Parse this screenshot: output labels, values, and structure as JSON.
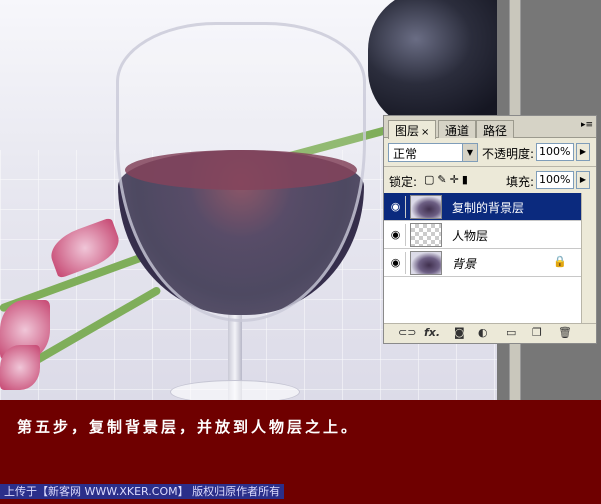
{
  "layers_panel": {
    "tabs": [
      {
        "label": "图层",
        "active": true,
        "close": "×"
      },
      {
        "label": "通道",
        "active": false
      },
      {
        "label": "路径",
        "active": false
      }
    ],
    "blend_mode": "正常",
    "opacity_label": "不透明度:",
    "opacity_value": "100%",
    "lock_label": "锁定:",
    "fill_label": "填充:",
    "fill_value": "100%",
    "layers": [
      {
        "name": "复制的背景层",
        "selected": true,
        "thumb": "photo"
      },
      {
        "name": "人物层",
        "selected": false,
        "thumb": "transparent"
      },
      {
        "name": "背景",
        "selected": false,
        "thumb": "photo",
        "locked": true
      }
    ],
    "bottom_icons": [
      "link-icon",
      "fx-icon",
      "mask-icon",
      "adjustment-icon",
      "folder-icon",
      "new-layer-icon",
      "trash-icon"
    ],
    "fx_label": "fx."
  },
  "caption": {
    "step_text": "第五步，复制背景层，并放到人物层之上。",
    "credit_text": "上传于【新客网 WWW.XKER.COM】 版权归原作者所有"
  },
  "colors": {
    "selected_layer": "#0b2a7e",
    "caption_bg": "#6f0000",
    "credit_bg": "#2b2f8a"
  }
}
